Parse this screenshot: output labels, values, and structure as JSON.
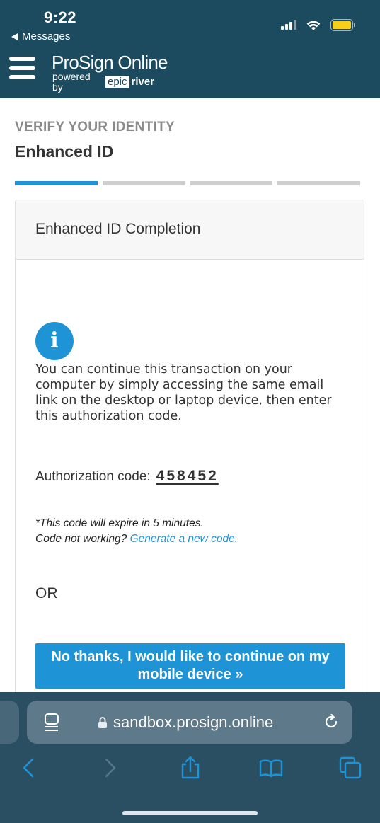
{
  "status_bar": {
    "time": "9:22",
    "back_app": "Messages",
    "icons": [
      "cellular-signal-icon",
      "wifi-icon",
      "battery-icon"
    ]
  },
  "header": {
    "brand": "ProSign Online",
    "powered_by": "powered by",
    "epic": "epic",
    "river": "river",
    "menu_icon": "hamburger-menu-icon"
  },
  "page": {
    "eyebrow": "VERIFY YOUR IDENTITY",
    "title": "Enhanced ID",
    "progress": {
      "steps": 4,
      "current": 1
    }
  },
  "card": {
    "heading": "Enhanced ID Completion",
    "info_icon": "info-icon",
    "info_text": "You can continue this transaction on your computer by simply accessing the same email link on the desktop or laptop device, then enter this authorization code.",
    "auth_label": "Authorization code:",
    "auth_code": "458452",
    "expire_note": "*This code will expire in 5 minutes.",
    "not_working": "Code not working?",
    "generate_link": "Generate a new code.",
    "or": "OR",
    "mobile_button": "No thanks, I would like to continue on my mobile device »"
  },
  "browser": {
    "url": "sandbox.prosign.online",
    "toolbar_icons": [
      "back-icon",
      "forward-icon",
      "share-icon",
      "bookmarks-icon",
      "tabs-icon"
    ]
  },
  "colors": {
    "header_bg": "#1c4a5f",
    "accent": "#1e94d6",
    "battery": "#f6cf1a",
    "safari_bg": "#2a4e62"
  }
}
